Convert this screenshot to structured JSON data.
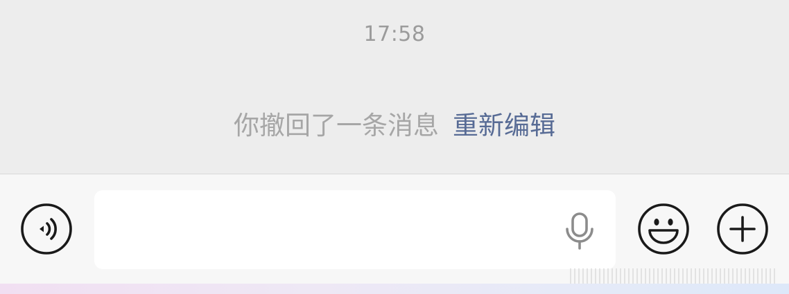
{
  "chat": {
    "timestamp": "17:58",
    "recall_notice": "你撤回了一条消息",
    "reedit_label": "重新编辑"
  },
  "input_bar": {
    "left_icon": "voice-mode-icon",
    "field_value": "",
    "field_icon": "microphone-icon",
    "emoji_icon": "smiley-face-icon",
    "more_icon": "plus-icon"
  },
  "colors": {
    "chat_background": "#ededed",
    "input_bar_background": "#f7f7f7",
    "link_blue": "#576b95",
    "notice_gray": "#a6a6a6",
    "timestamp_gray": "#9b9b9b"
  }
}
